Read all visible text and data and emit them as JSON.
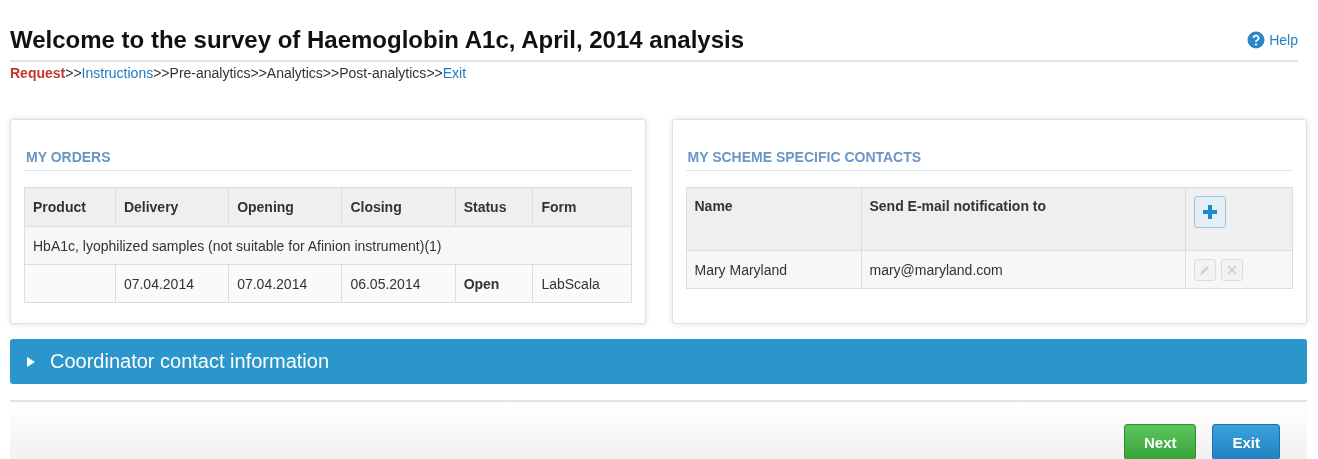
{
  "header": {
    "title": "Welcome to the survey of Haemoglobin A1c, April, 2014 analysis",
    "help": "Help"
  },
  "breadcrumb": [
    {
      "label": "Request",
      "kind": "current"
    },
    {
      "label": ">>",
      "kind": "separator"
    },
    {
      "label": "Instructions",
      "kind": "link"
    },
    {
      "label": ">>",
      "kind": "separator"
    },
    {
      "label": "Pre-analytics",
      "kind": "plain"
    },
    {
      "label": ">>",
      "kind": "separator"
    },
    {
      "label": "Analytics",
      "kind": "plain"
    },
    {
      "label": ">>",
      "kind": "separator"
    },
    {
      "label": "Post-analytics",
      "kind": "plain"
    },
    {
      "label": ">>",
      "kind": "separator"
    },
    {
      "label": "Exit",
      "kind": "link"
    }
  ],
  "orders": {
    "title": "MY ORDERS",
    "columns": [
      "Product",
      "Delivery",
      "Opening",
      "Closing",
      "Status",
      "Form"
    ],
    "product": "HbA1c, lyophilized samples (not suitable for Afinion instrument)(1)",
    "rows": [
      {
        "product": "",
        "delivery": "07.04.2014",
        "opening": "07.04.2014",
        "closing": "06.05.2014",
        "status": "Open",
        "form": "LabScala"
      }
    ]
  },
  "contacts": {
    "title": "MY SCHEME SPECIFIC CONTACTS",
    "columns": [
      "Name",
      "Send E-mail notification to"
    ],
    "rows": [
      {
        "name": "Mary Maryland",
        "email": "mary@maryland.com",
        "disabled": true
      }
    ]
  },
  "coordinator": {
    "label": "Coordinator contact information",
    "expanded": false
  },
  "buttons": [
    {
      "label": "Next",
      "kind": "primary"
    },
    {
      "label": "Exit",
      "kind": "secondary"
    }
  ]
}
